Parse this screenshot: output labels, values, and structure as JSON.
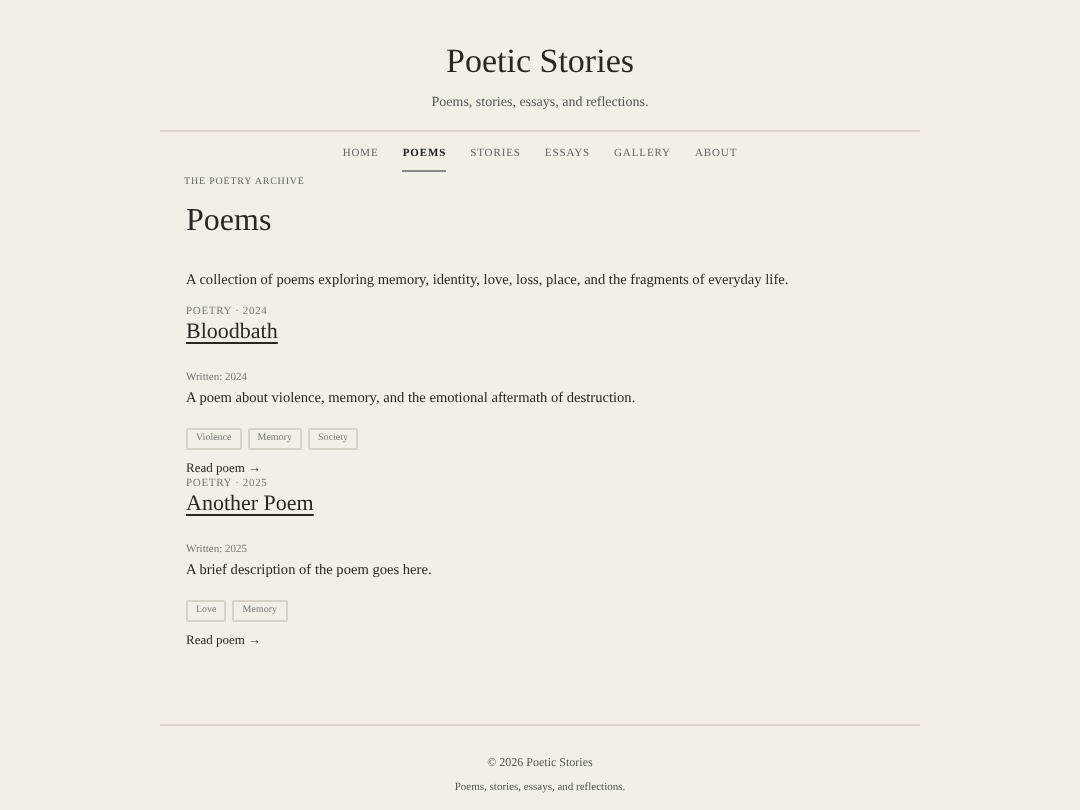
{
  "site": {
    "title": "Poetic Stories",
    "tagline": "Poems, stories, essays, and reflections."
  },
  "nav": [
    {
      "label": "HOME",
      "selected": false
    },
    {
      "label": "POEMS",
      "selected": true
    },
    {
      "label": "STORIES",
      "selected": false
    },
    {
      "label": "ESSAYS",
      "selected": false
    },
    {
      "label": "GALLERY",
      "selected": false
    },
    {
      "label": "ABOUT",
      "selected": false
    }
  ],
  "eyebrow": "THE POETRY ARCHIVE",
  "heading": "Poems",
  "intro": "A collection of poems exploring memory, identity, love, loss, place, and the fragments of everyday life.",
  "posts": [
    {
      "meta": "POETRY · 2024",
      "title": "Bloodbath",
      "written": "Written: 2024",
      "summary": "A poem about violence, memory, and the emotional aftermath of destruction.",
      "tags": [
        "Violence",
        "Memory",
        "Society"
      ],
      "link": "Read poem →"
    },
    {
      "meta": "POETRY · 2025",
      "title": "Another Poem",
      "written": "Written: 2025",
      "summary": "A brief description of the poem goes here.",
      "tags": [
        "Love",
        "Memory"
      ],
      "link": "Read poem →"
    }
  ],
  "footer": {
    "copyright": "© 2026 Poetic Stories",
    "tagline": "Poems, stories, essays, and reflections."
  }
}
